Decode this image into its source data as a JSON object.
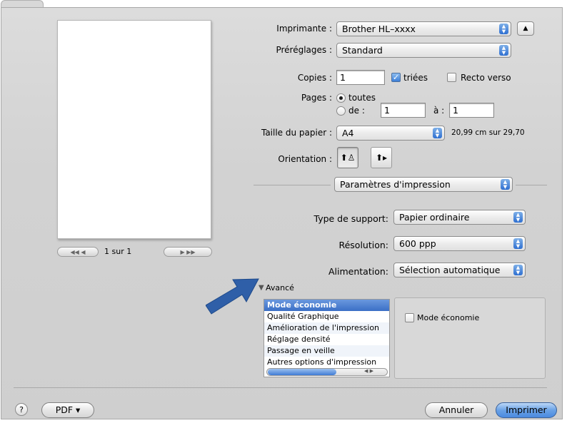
{
  "preview": {
    "page_indicator": "1 sur 1",
    "prev_glyphs": "◀◀  ◀",
    "next_glyphs": "▶  ▶▶"
  },
  "printer": {
    "label": "Imprimante :",
    "value": "Brother HL–xxxx"
  },
  "presets": {
    "label": "Préréglages :",
    "value": "Standard"
  },
  "copies": {
    "label": "Copies :",
    "value": "1",
    "collated_label": "triées",
    "collated": true,
    "duplex_label": "Recto verso",
    "duplex": false
  },
  "pages": {
    "label": "Pages :",
    "all_label": "toutes",
    "from_label": "de :",
    "from_value": "1",
    "to_label": "à :",
    "to_value": "1",
    "selected": "toutes"
  },
  "paper": {
    "label": "Taille du papier :",
    "value": "A4",
    "dims": "20,99 cm sur 29,70"
  },
  "orientation": {
    "label": "Orientation :"
  },
  "section": {
    "value": "Paramètres d'impression"
  },
  "media": {
    "label": "Type de support:",
    "value": "Papier ordinaire"
  },
  "resolution": {
    "label": "Résolution:",
    "value": "600 ppp"
  },
  "feed": {
    "label": "Alimentation:",
    "value": "Sélection automatique"
  },
  "advanced": {
    "label": "Avancé",
    "items": [
      "Mode économie",
      "Qualité Graphique",
      "Amélioration de l'impression",
      "Réglage densité",
      "Passage en veille",
      "Autres options d'impression"
    ],
    "selected_index": 0,
    "eco_checkbox_label": "Mode économie",
    "eco_checked": false
  },
  "bottom": {
    "help": "?",
    "pdf": "PDF ▾",
    "cancel": "Annuler",
    "print": "Imprimer"
  },
  "colors": {
    "accent": "#3b6fc6",
    "callout_arrow": "#2f5fa8"
  }
}
